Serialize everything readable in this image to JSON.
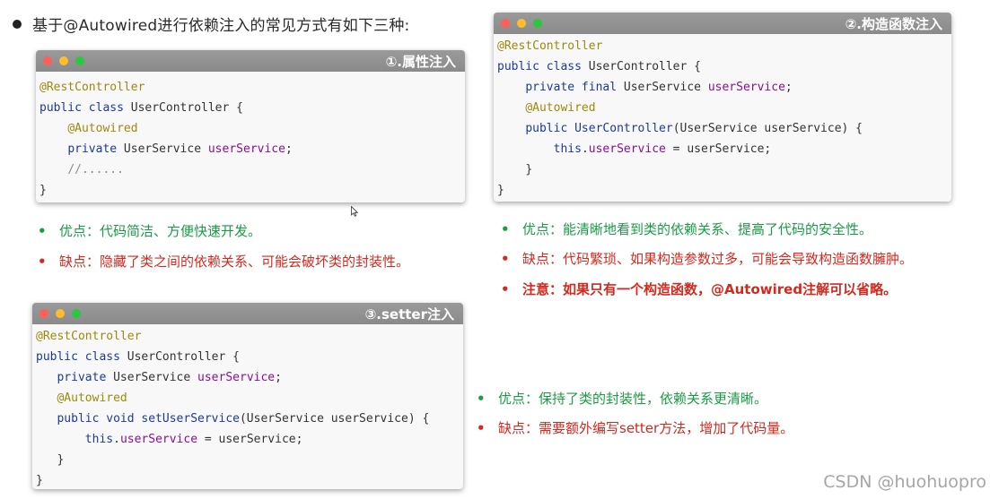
{
  "heading": "基于@Autowired进行依赖注入的常见方式有如下三种:",
  "cards": {
    "field": {
      "title": "①.属性注入",
      "lines": {
        "l1": "@RestController",
        "l2a": "public class",
        "l2b": " UserController {",
        "l3": "@Autowired",
        "l4a": "private",
        "l4b": " UserService ",
        "l4c": "userService",
        "l4d": ";",
        "l5": "//......",
        "l6": "}"
      }
    },
    "constructor": {
      "title": "②.构造函数注入",
      "lines": {
        "l1": "@RestController",
        "l2a": "public class",
        "l2b": " UserController {",
        "l3a": "private final",
        "l3b": " UserService ",
        "l3c": "userService",
        "l3d": ";",
        "l4": "@Autowired",
        "l5a": "public",
        "l5b": "UserController",
        "l5c": "(UserService userService) {",
        "l6a": "this",
        "l6b": ".",
        "l6c": "userService",
        "l6d": " = userService;",
        "l7": "}",
        "l8": "}"
      }
    },
    "setter": {
      "title": "③.setter注入",
      "lines": {
        "l1": "@RestController",
        "l2a": "public class",
        "l2b": " UserController {",
        "l3a": "private",
        "l3b": " UserService ",
        "l3c": "userService",
        "l3d": ";",
        "l4": "@Autowired",
        "l5a": "public void",
        "l5b": "setUserService",
        "l5c": "(UserService userService) {",
        "l6a": "this",
        "l6b": ".",
        "l6c": "userService",
        "l6d": " = userService;",
        "l7": "}",
        "l8": "}"
      }
    }
  },
  "notes": {
    "field": {
      "pro": "优点：代码简洁、方便快速开发。",
      "con": "缺点：隐藏了类之间的依赖关系、可能会破坏类的封装性。"
    },
    "constructor": {
      "pro": "优点：能清晰地看到类的依赖关系、提高了代码的安全性。",
      "con": "缺点：代码繁琐、如果构造参数过多，可能会导致构造函数臃肿。",
      "warn": "注意：如果只有一个构造函数，@Autowired注解可以省略。"
    },
    "setter": {
      "pro": "优点：保持了类的封装性，依赖关系更清晰。",
      "con": "缺点：需要额外编写setter方法，增加了代码量。"
    }
  },
  "bullet_glyph": "•",
  "watermark": "CSDN @huohuopro",
  "colors": {
    "pro": "#1a9b45",
    "con": "#d12a1f",
    "annotation": "#9e880d",
    "keyword": "#1b3a9b",
    "field": "#871094"
  }
}
